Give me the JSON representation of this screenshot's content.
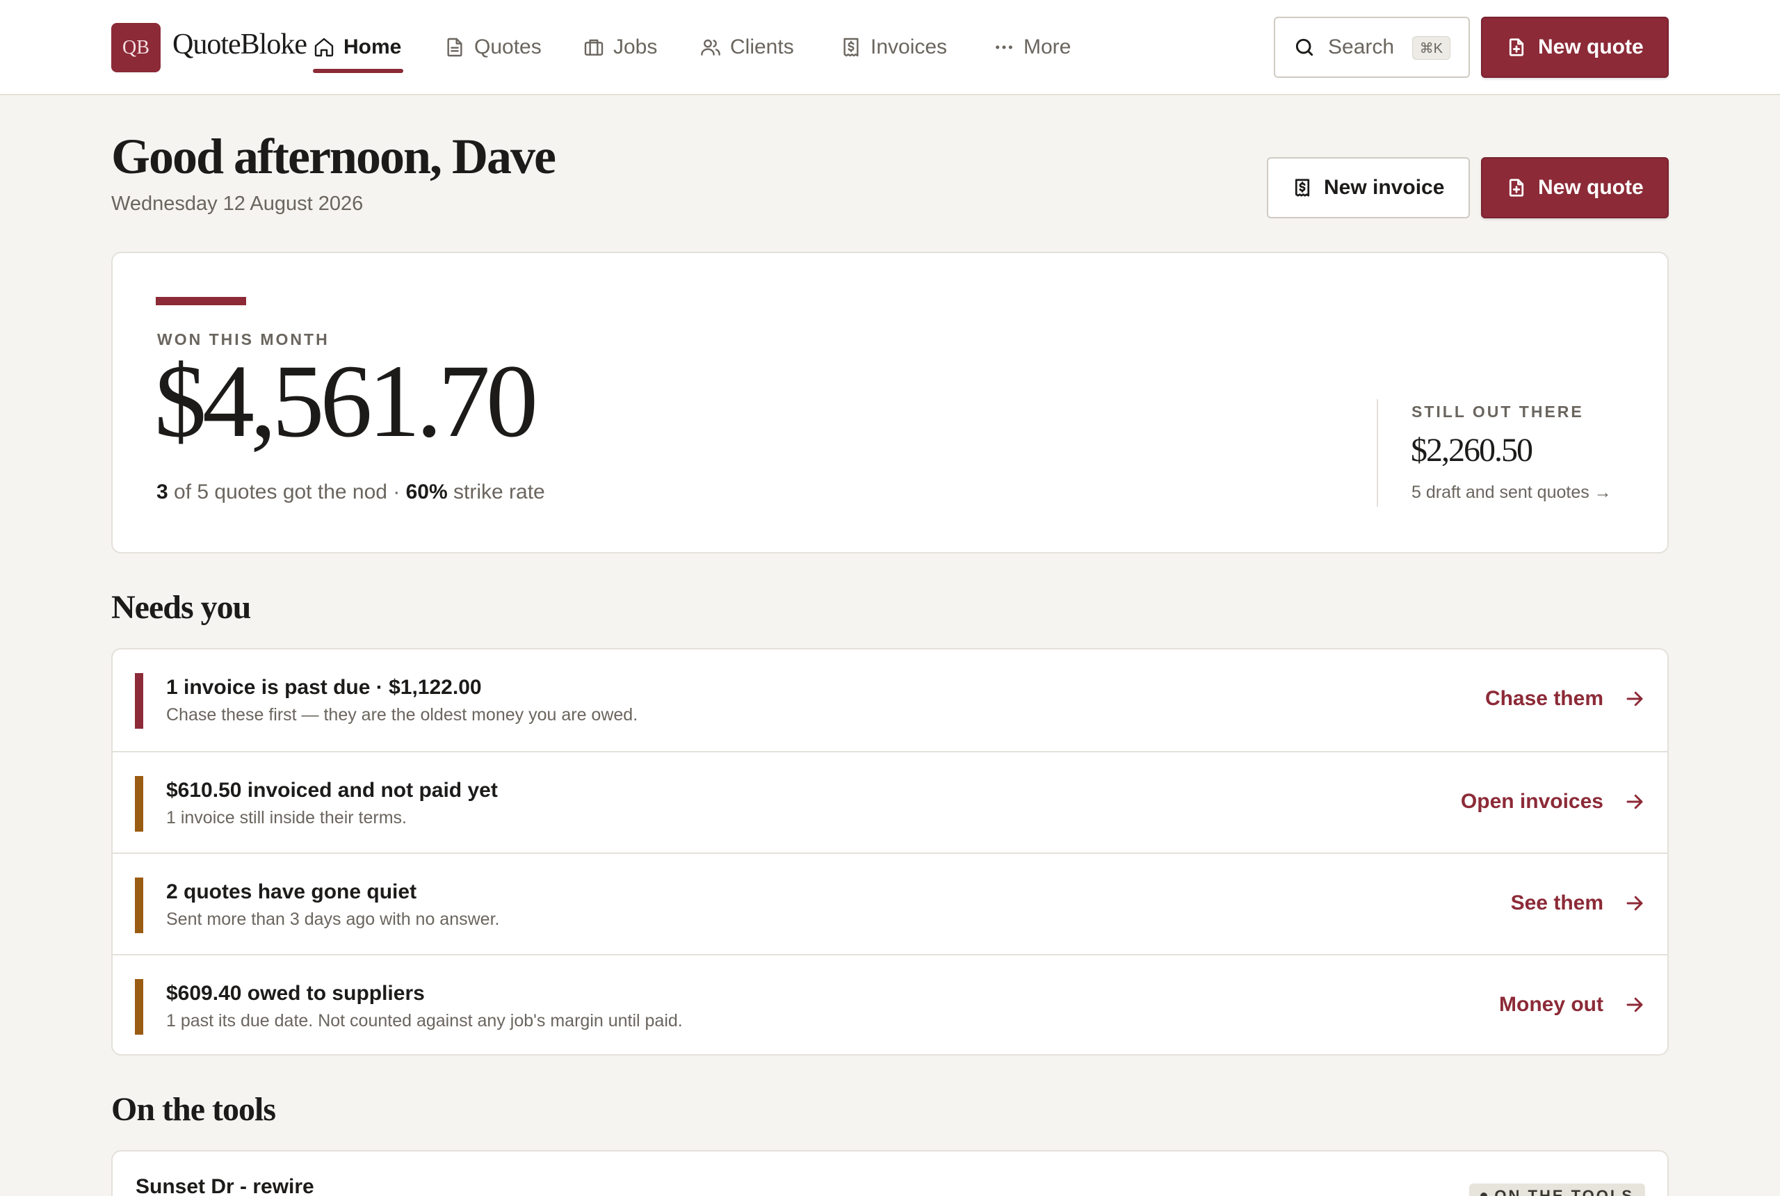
{
  "app": {
    "logo_initials": "QB",
    "name": "QuoteBloke"
  },
  "nav": {
    "items": [
      {
        "label": "Home",
        "icon": "home-icon",
        "active": true
      },
      {
        "label": "Quotes",
        "icon": "document-icon",
        "active": false
      },
      {
        "label": "Jobs",
        "icon": "briefcase-icon",
        "active": false
      },
      {
        "label": "Clients",
        "icon": "users-icon",
        "active": false
      },
      {
        "label": "Invoices",
        "icon": "receipt-icon",
        "active": false
      },
      {
        "label": "More",
        "icon": "ellipsis-icon",
        "active": false
      }
    ],
    "search_label": "Search",
    "search_shortcut": "⌘K",
    "new_quote_label": "New quote"
  },
  "header": {
    "greeting": "Good afternoon, Dave",
    "date": "Wednesday 12 August 2026",
    "new_invoice_label": "New invoice",
    "new_quote_label": "New quote"
  },
  "summary": {
    "won_label": "WON THIS MONTH",
    "won_amount": "$4,561.70",
    "won_count": "3",
    "won_text": "of 5 quotes got the nod ·",
    "strike_rate": "60%",
    "strike_rate_label": "strike rate",
    "out_label": "STILL OUT THERE",
    "out_amount": "$2,260.50",
    "out_link": "5 draft and sent quotes →"
  },
  "needs_you": {
    "title": "Needs you",
    "items": [
      {
        "title": "1 invoice is past due · $1,122.00",
        "subtitle": "Chase these first — they are the oldest money you are owed.",
        "action": "Chase them",
        "severity_color": "#8c2a37"
      },
      {
        "title": "$610.50 invoiced and not paid yet",
        "subtitle": "1 invoice still inside their terms.",
        "action": "Open invoices",
        "severity_color": "#9a5b12"
      },
      {
        "title": "2 quotes have gone quiet",
        "subtitle": "Sent more than 3 days ago with no answer.",
        "action": "See them",
        "severity_color": "#9a5b12"
      },
      {
        "title": "$609.40 owed to suppliers",
        "subtitle": "1 past its due date. Not counted against any job's margin until paid.",
        "action": "Money out",
        "severity_color": "#9a5b12"
      }
    ]
  },
  "on_the_tools": {
    "title": "On the tools",
    "jobs": [
      {
        "title": "Sunset Dr - rewire",
        "status": "ON THE TOOLS"
      }
    ]
  },
  "colors": {
    "brand": "#8c2a37",
    "warning": "#9a5b12",
    "background": "#f5f4f0"
  }
}
